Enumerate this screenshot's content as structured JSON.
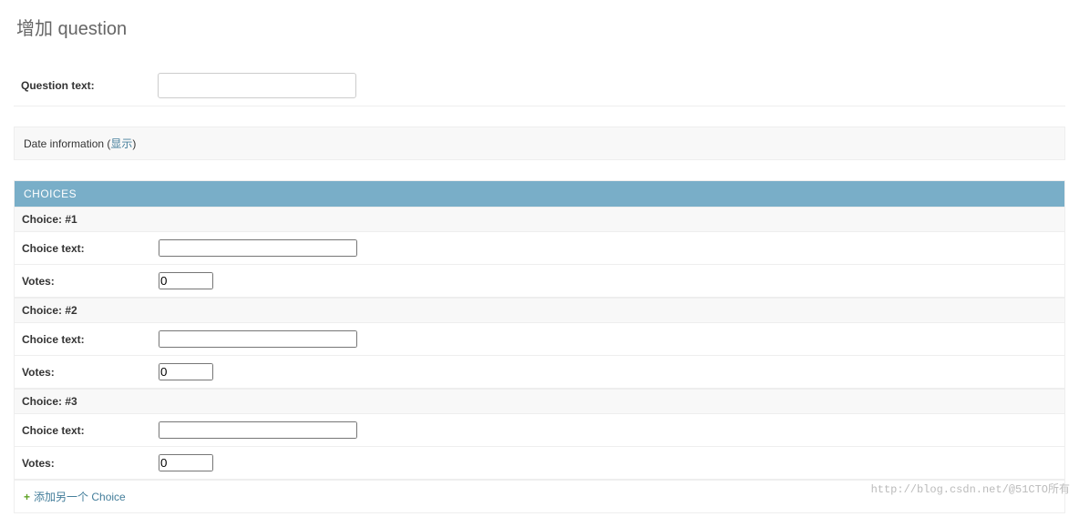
{
  "page": {
    "title": "增加 question"
  },
  "question": {
    "text_label": "Question text:",
    "text_value": ""
  },
  "date_info": {
    "label": "Date information",
    "toggle_text": "显示"
  },
  "choices": {
    "header": "CHOICES",
    "choice_text_label": "Choice text:",
    "votes_label": "Votes:",
    "items": [
      {
        "header": "Choice: #1",
        "text_value": "",
        "votes_value": "0"
      },
      {
        "header": "Choice: #2",
        "text_value": "",
        "votes_value": "0"
      },
      {
        "header": "Choice: #3",
        "text_value": "",
        "votes_value": "0"
      }
    ],
    "add_label": "添加另一个 Choice"
  },
  "watermark": "http://blog.csdn.net/@51CTO所有"
}
